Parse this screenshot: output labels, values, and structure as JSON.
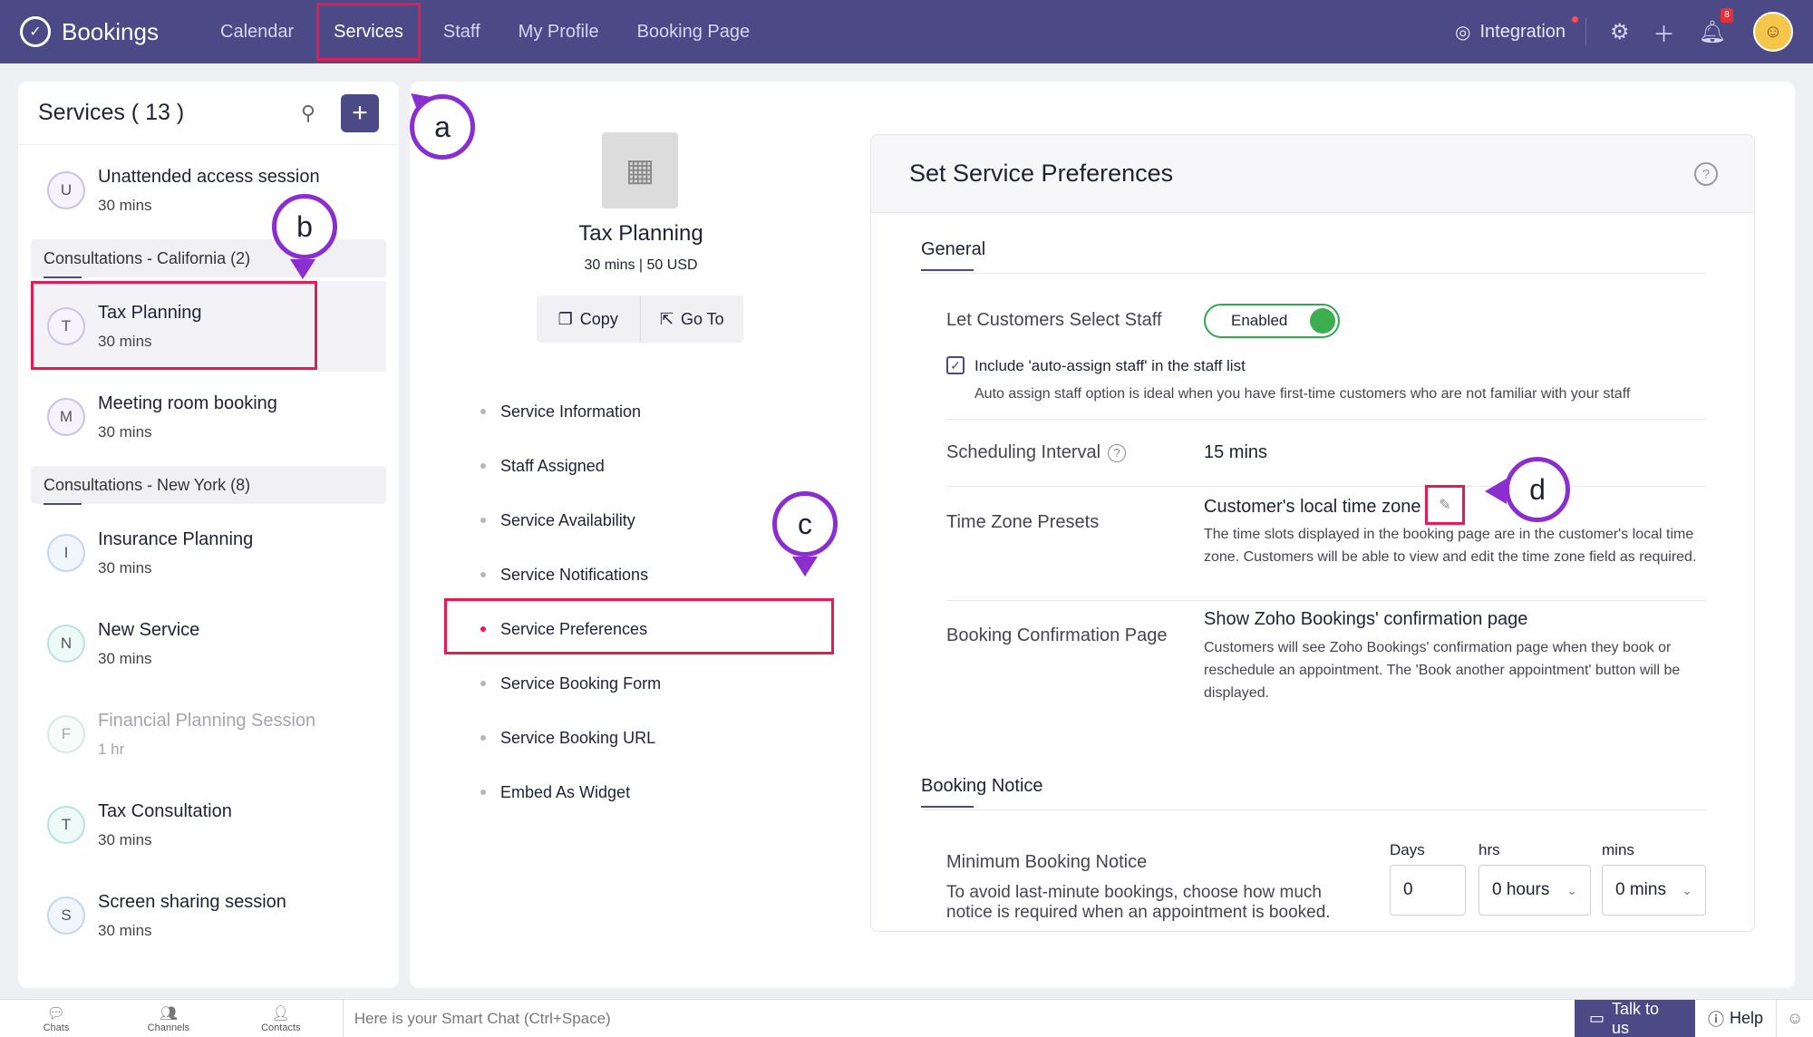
{
  "nav": {
    "brand": "Bookings",
    "items": [
      "Calendar",
      "Services",
      "Staff",
      "My Profile",
      "Booking Page"
    ],
    "integration": "Integration",
    "notification_count": "8"
  },
  "services_panel": {
    "title": "Services ( 13 )",
    "ungrouped": [
      {
        "initial": "U",
        "name": "Unattended access session",
        "duration": "30 mins"
      }
    ],
    "group_california": "Consultations - California (2)",
    "california": [
      {
        "initial": "T",
        "name": "Tax Planning",
        "duration": "30 mins"
      },
      {
        "initial": "M",
        "name": "Meeting room booking",
        "duration": "30 mins"
      }
    ],
    "group_newyork": "Consultations - New York (8)",
    "newyork": [
      {
        "initial": "I",
        "name": "Insurance Planning",
        "duration": "30 mins"
      },
      {
        "initial": "N",
        "name": "New Service",
        "duration": "30 mins"
      },
      {
        "initial": "F",
        "name": "Financial Planning Session",
        "duration": "1 hr"
      },
      {
        "initial": "T",
        "name": "Tax Consultation",
        "duration": "30 mins"
      },
      {
        "initial": "S",
        "name": "Screen sharing session",
        "duration": "30 mins"
      }
    ]
  },
  "service": {
    "title": "Tax Planning",
    "meta": "30 mins | 50 USD",
    "copy_label": "Copy",
    "goto_label": "Go To",
    "menu": [
      "Service Information",
      "Staff Assigned",
      "Service Availability",
      "Service Notifications",
      "Service Preferences",
      "Service Booking Form",
      "Service Booking URL",
      "Embed As Widget"
    ]
  },
  "preferences": {
    "title": "Set Service Preferences",
    "general": "General",
    "select_staff_label": "Let Customers Select Staff",
    "select_staff_value": "Enabled",
    "auto_assign_label": "Include 'auto-assign staff' in the staff list",
    "auto_assign_desc": "Auto assign staff option is ideal when you have first-time customers who are not familiar with your staff",
    "interval_label": "Scheduling Interval",
    "interval_value": "15 mins",
    "tz_label": "Time Zone Presets",
    "tz_value": "Customer's local time zone",
    "tz_desc": "The time slots displayed in the booking page are in the customer's local time zone. Customers will be able to view and edit the time zone field as required.",
    "confirm_label": "Booking Confirmation Page",
    "confirm_value": "Show Zoho Bookings' confirmation page",
    "confirm_desc": "Customers will see Zoho Bookings' confirmation page when they book or reschedule an appointment. The 'Book another appointment' button will be displayed.",
    "booking_notice": "Booking Notice",
    "min_notice_label": "Minimum Booking Notice",
    "min_notice_desc": "To avoid last-minute bookings, choose how much notice is required when an appointment is booked.",
    "days_label": "Days",
    "days_value": "0",
    "hrs_label": "hrs",
    "hrs_value": "0 hours",
    "mins_label": "mins",
    "mins_value": "0 mins"
  },
  "callouts": [
    "a",
    "b",
    "c",
    "d"
  ],
  "bottombar": {
    "chats": "Chats",
    "channels": "Channels",
    "contacts": "Contacts",
    "smartchat": "Here is your Smart Chat (Ctrl+Space)",
    "talk": "Talk to us",
    "help": "Help"
  },
  "colors": {
    "nav_bg": "#4b4a86",
    "highlight": "#e8194f",
    "callout": "#8a2ed0",
    "toggle_on": "#3cae4f"
  }
}
